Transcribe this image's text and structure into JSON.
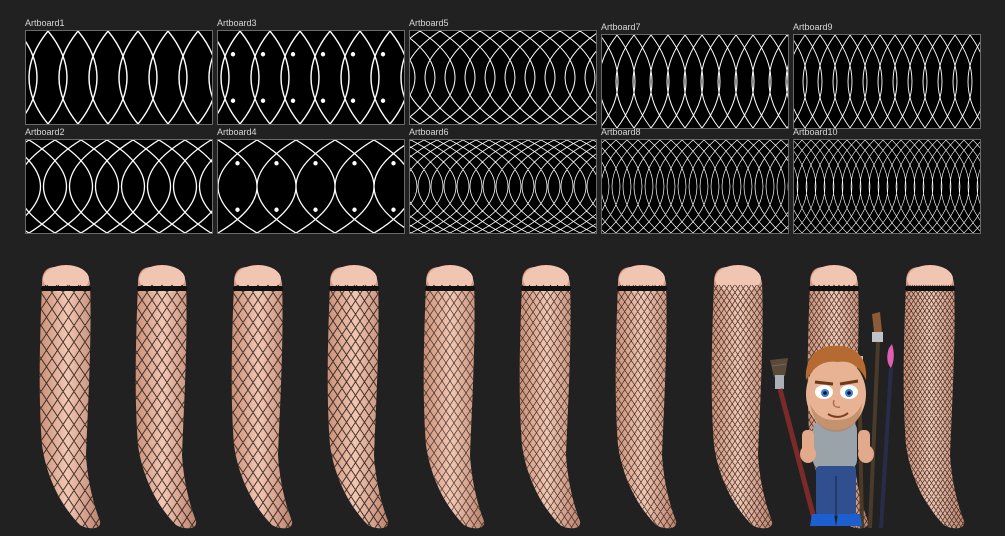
{
  "artboards": {
    "row1": [
      {
        "label": "Artboard1"
      },
      {
        "label": "Artboard3"
      },
      {
        "label": "Artboard5"
      },
      {
        "label": "Artboard7"
      },
      {
        "label": "Artboard9"
      }
    ],
    "row2": [
      {
        "label": "Artboard2"
      },
      {
        "label": "Artboard4"
      },
      {
        "label": "Artboard6"
      },
      {
        "label": "Artboard8"
      },
      {
        "label": "Artboard10"
      }
    ]
  },
  "preview_legs": {
    "count": 10
  },
  "colors": {
    "canvas": "#212121",
    "artboard_bg": "#000000",
    "mesh": "#ffffff",
    "skin": "#e9b9a6",
    "band": "#111111"
  }
}
